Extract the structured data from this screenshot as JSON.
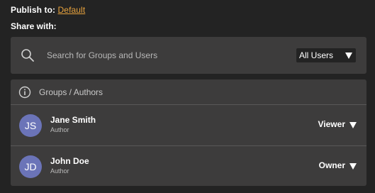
{
  "publish": {
    "label": "Publish to:",
    "target": "Default"
  },
  "share": {
    "label": "Share with:"
  },
  "search": {
    "placeholder": "Search for Groups and Users",
    "scope": "All Users"
  },
  "list": {
    "header": "Groups / Authors",
    "entries": [
      {
        "initials": "JS",
        "name": "Jane Smith",
        "role": "Author",
        "permission": "Viewer"
      },
      {
        "initials": "JD",
        "name": "John Doe",
        "role": "Author",
        "permission": "Owner"
      }
    ]
  },
  "colors": {
    "accent": "#e8a33d",
    "avatar": "#6b74b8",
    "panel": "#3d3c3c",
    "background": "#232323"
  },
  "icons": {
    "search": "search-icon",
    "info": "info-icon",
    "dropdown": "chevron-down-icon"
  }
}
